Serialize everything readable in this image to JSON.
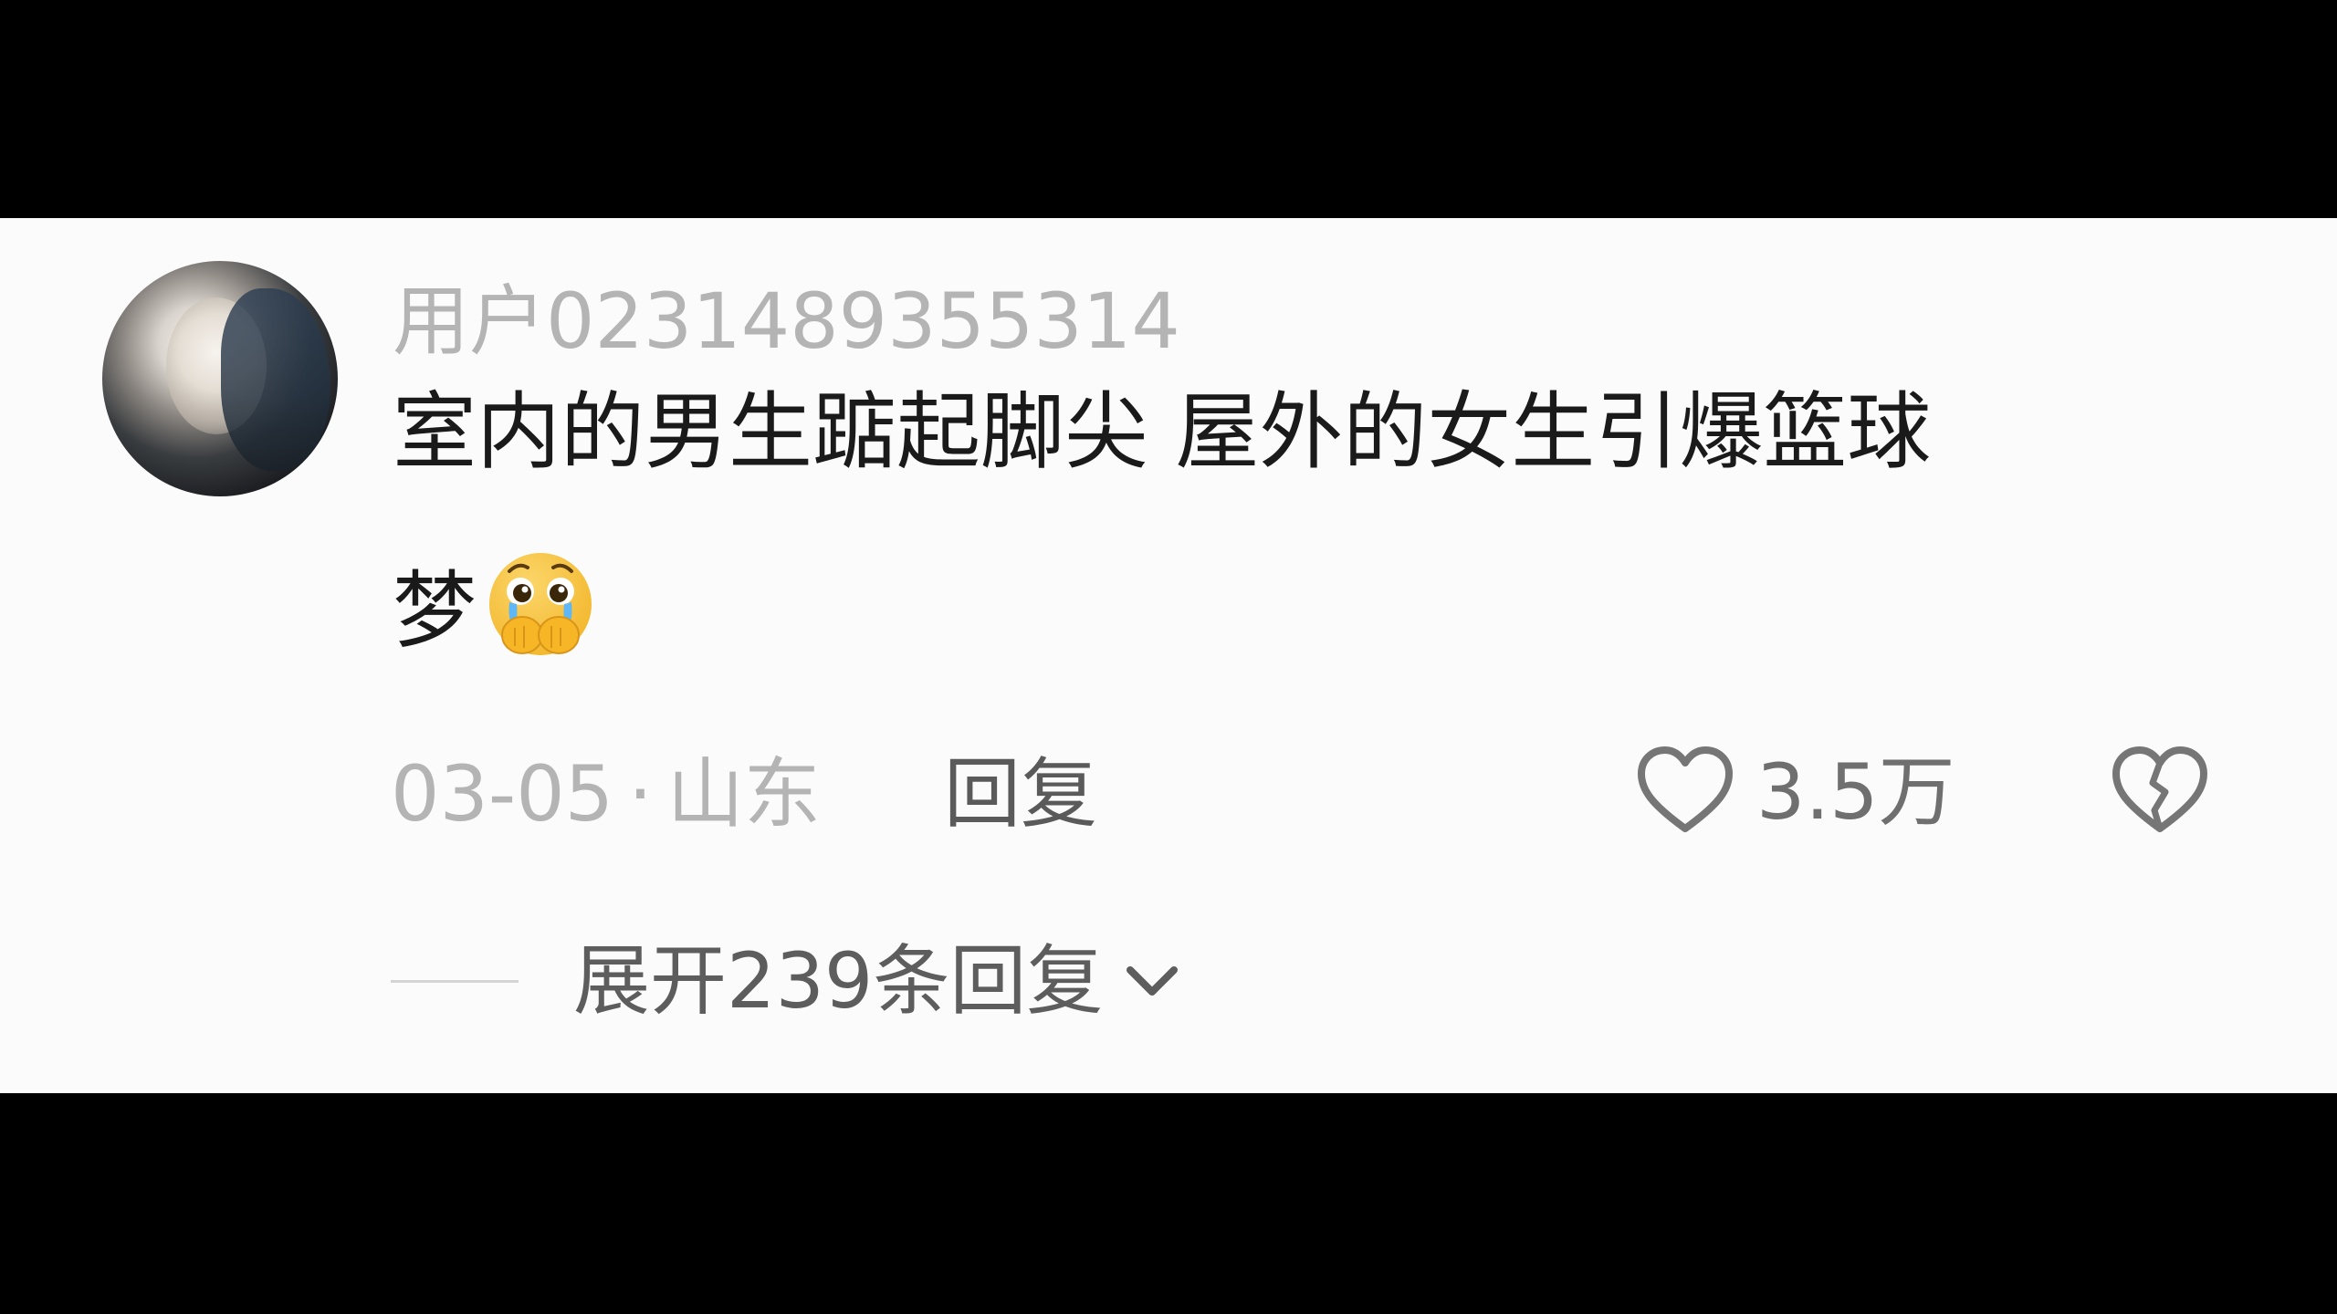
{
  "comment": {
    "username": "用户0231489355314",
    "text_line1": "室内的男生踮起脚尖 屋外的女生引爆篮球",
    "text_line2": "梦",
    "emoji": "pleading-face-crying-emoji",
    "date": "03-05",
    "separator": "·",
    "location": "山东",
    "reply_label": "回复",
    "like_count": "3.5万",
    "expand_label": "展开239条回复"
  },
  "icons": {
    "like": "heart-outline-icon",
    "dislike": "broken-heart-icon",
    "expand": "chevron-down-icon"
  },
  "colors": {
    "background": "#fbfbfb",
    "letterbox": "#000000",
    "primary_text": "#1a1a1a",
    "secondary_text": "#b4b4b4",
    "reply_text": "#5a5a5a",
    "emoji_yellow": "#f9c43a"
  }
}
